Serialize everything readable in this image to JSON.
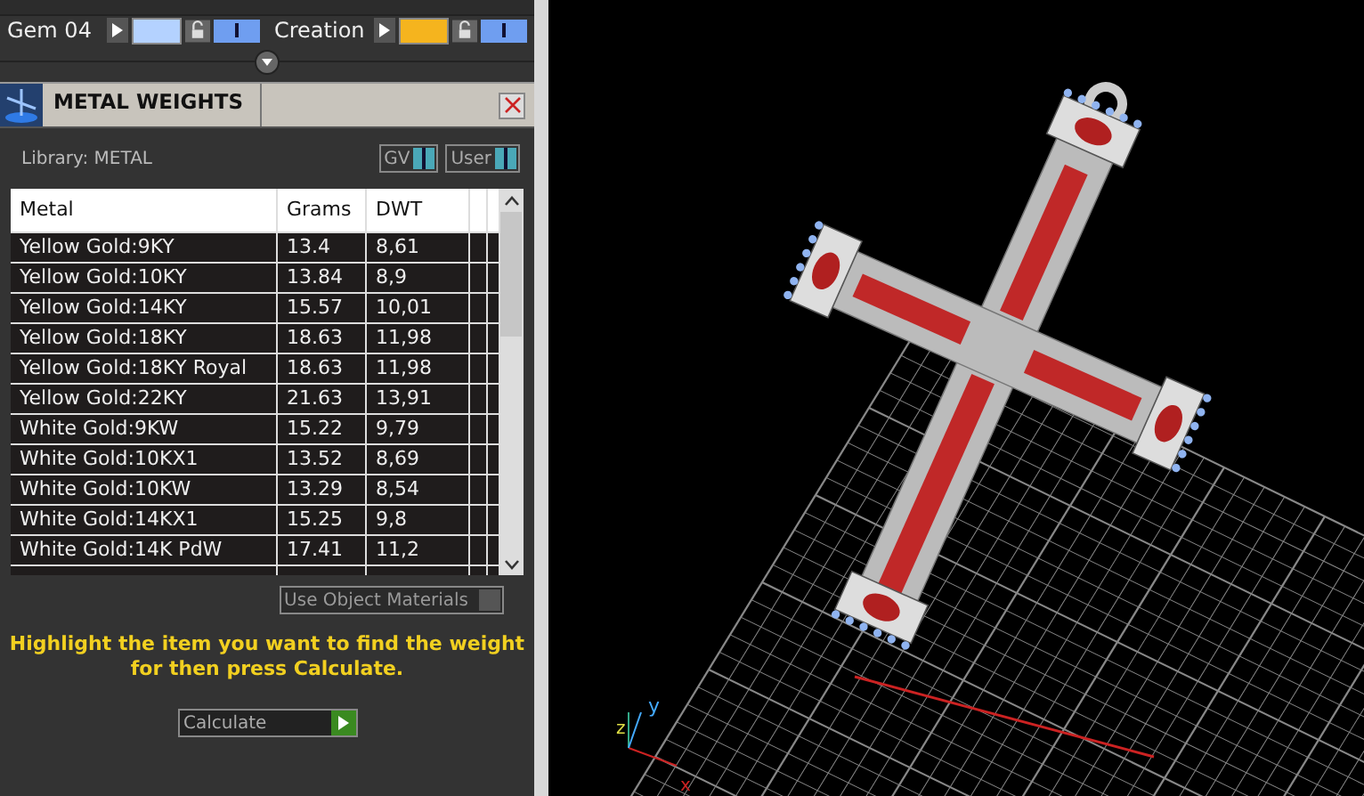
{
  "gem_rows": [
    {
      "label": "Gem 04",
      "color": "#b4d2ff"
    },
    {
      "label": "Creation",
      "color": "#f5b41e"
    }
  ],
  "panel": {
    "title": "METAL WEIGHTS",
    "library": "Library: METAL",
    "toggles": [
      {
        "label": "GV",
        "on": true
      },
      {
        "label": "User",
        "on": true
      }
    ]
  },
  "table": {
    "columns": [
      "Metal",
      "Grams",
      "DWT"
    ],
    "rows": [
      [
        "Yellow Gold:9KY",
        "13.4",
        "8,61"
      ],
      [
        "Yellow Gold:10KY",
        "13.84",
        "8,9"
      ],
      [
        "Yellow Gold:14KY",
        "15.57",
        "10,01"
      ],
      [
        "Yellow Gold:18KY",
        "18.63",
        "11,98"
      ],
      [
        "Yellow Gold:18KY Royal",
        "18.63",
        "11,98"
      ],
      [
        "Yellow Gold:22KY",
        "21.63",
        "13,91"
      ],
      [
        "White Gold:9KW",
        "15.22",
        "9,79"
      ],
      [
        "White Gold:10KX1",
        "13.52",
        "8,69"
      ],
      [
        "White Gold:10KW",
        "13.29",
        "8,54"
      ],
      [
        "White Gold:14KX1",
        "15.25",
        "9,8"
      ],
      [
        "White Gold:14K PdW",
        "17.41",
        "11,2"
      ]
    ]
  },
  "use_object_materials": {
    "label": "Use Object Materials",
    "checked": false
  },
  "message": "Highlight the item you want to find the weight for then press Calculate.",
  "calculate_button": "Calculate",
  "viewport": {
    "axis_labels": [
      "y",
      "z",
      "x"
    ]
  }
}
